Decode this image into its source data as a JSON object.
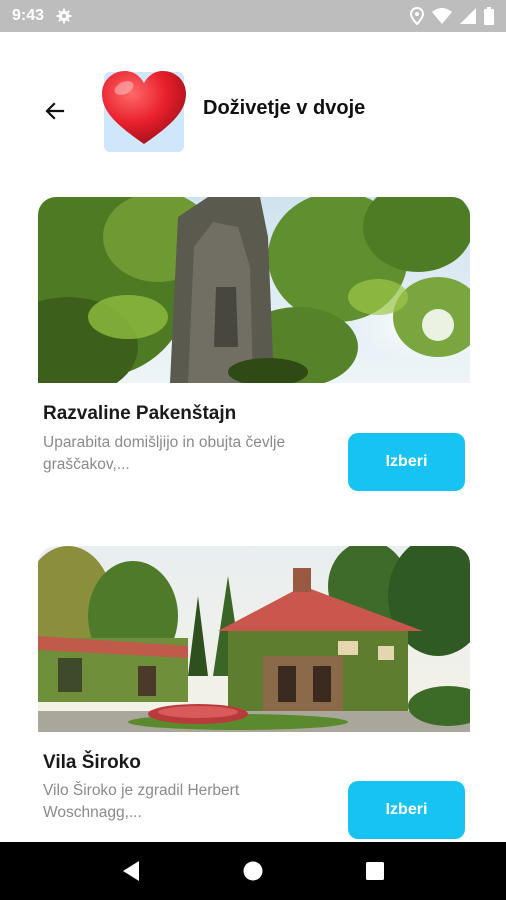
{
  "status_bar": {
    "time": "9:43",
    "icons": [
      "settings-icon",
      "location-icon",
      "wifi-icon",
      "signal-icon",
      "battery-icon"
    ]
  },
  "header": {
    "title": "Doživetje v dvoje",
    "back_icon": "arrow-left-icon",
    "category_icon": "heart-icon"
  },
  "cards": [
    {
      "title": "Razvaline Pakenštajn",
      "description": "Uparabita domišljijo in obujta čevlje graščakov,...",
      "button_label": "Izberi",
      "image": "ruins-in-forest-photo"
    },
    {
      "title": "Vila Široko",
      "description": "Vilo Široko je zgradil Herbert Woschnagg,...",
      "button_label": "Izberi",
      "image": "villa-with-ivy-photo"
    }
  ],
  "nav_bar": {
    "icons": [
      "back-triangle-icon",
      "home-circle-icon",
      "recents-square-icon"
    ]
  },
  "colors": {
    "accent": "#17c3f3",
    "status_bar": "#bdbdbd",
    "heart": "#e8202c",
    "icon_bg": "#cfe6fb"
  }
}
